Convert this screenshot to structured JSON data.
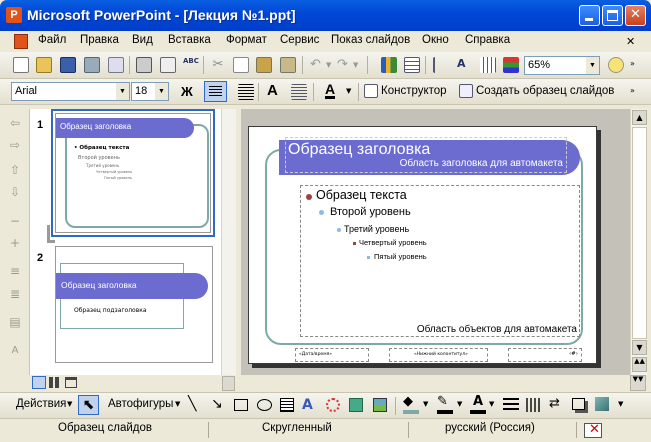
{
  "window": {
    "title": "Microsoft PowerPoint - [Лекция №1.ppt]"
  },
  "menu": [
    "Файл",
    "Правка",
    "Вид",
    "Вставка",
    "Формат",
    "Сервис",
    "Показ слайдов",
    "Окно",
    "Справка"
  ],
  "toolbar_standard": {
    "zoom": "65%"
  },
  "toolbar_format": {
    "font": "Arial",
    "size": "18",
    "bold_label": "Ж",
    "designer_label": "Конструктор",
    "create_master_label": "Создать образец слайдов"
  },
  "thumbnails": [
    {
      "number": "1",
      "title": "Образец заголовка",
      "l1": "• Образец текста",
      "l2": "Второй уровень",
      "l3": "Третий уровень",
      "l4": "Четвертый уровень",
      "l5": "Пятый уровень"
    },
    {
      "number": "2",
      "title": "Образец заголовка",
      "subtitle": "Образец подзаголовка"
    }
  ],
  "slide": {
    "title": "Образец заголовка",
    "title_area_label": "Область заголовка для автомакета",
    "level1": "Образец текста",
    "level2": "Второй уровень",
    "level3": "Третий уровень",
    "level4": "Четвертый уровень",
    "level5": "Пятый уровень",
    "body_area_label": "Область объектов для автомакета",
    "footer_left": "«Дата/время»",
    "footer_center": "«Нижний колонтитул»",
    "footer_right": "‹#›"
  },
  "draw_toolbar": {
    "actions_label": "Действия",
    "autoshapes_label": "Автофигуры"
  },
  "status": {
    "view": "Образец слайдов",
    "design": "Скругленный",
    "language": "русский (Россия)"
  },
  "colors": {
    "title_accent": "#6b6bd0",
    "frame_green": "#6a9a98",
    "titlebar": "#0054e3"
  }
}
